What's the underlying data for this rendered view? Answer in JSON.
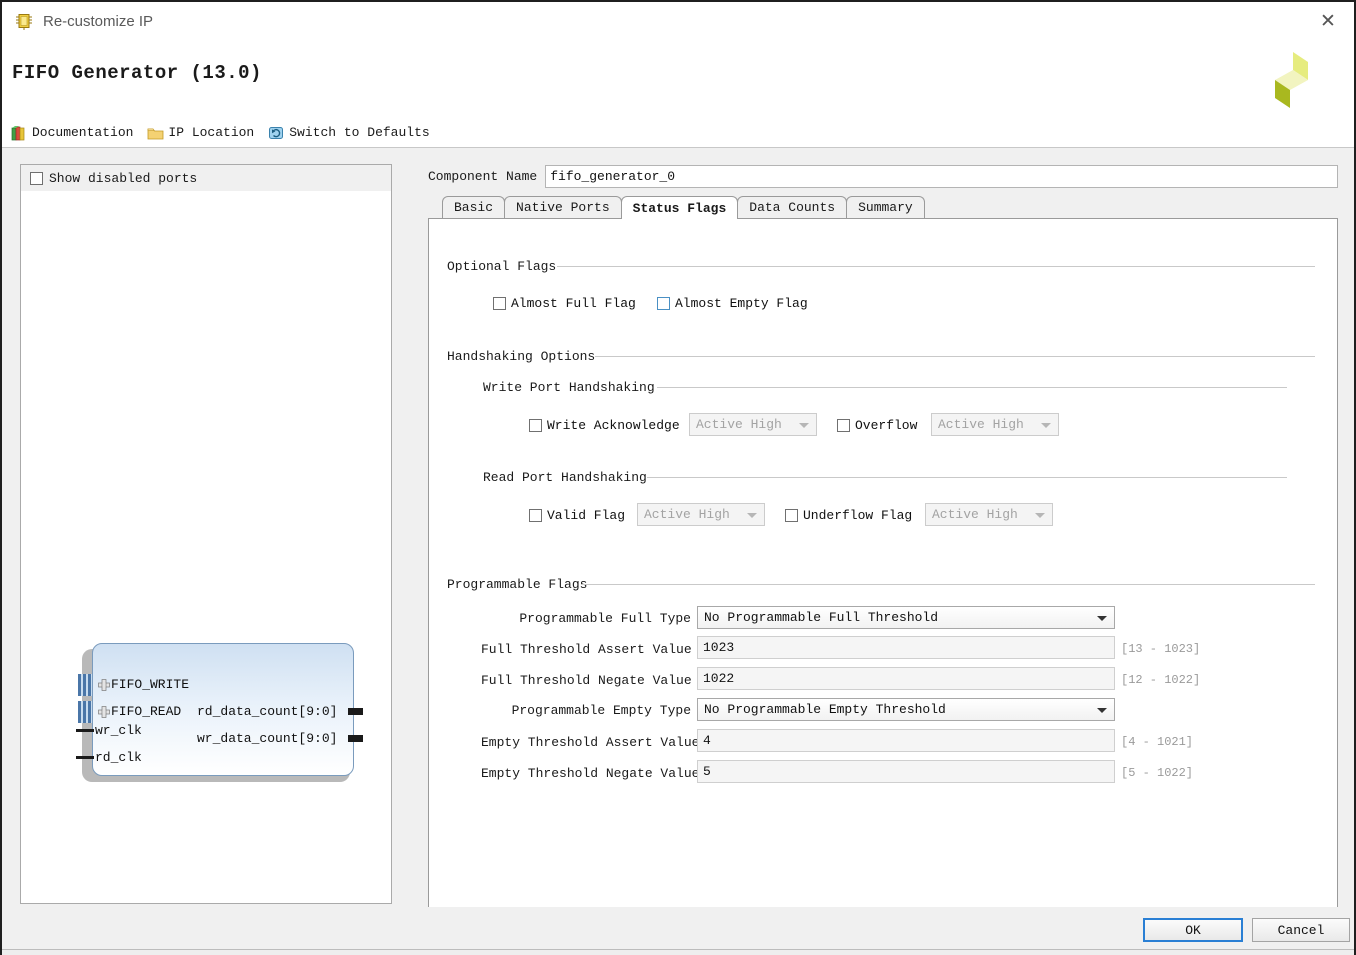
{
  "window": {
    "title": "Re-customize IP",
    "title_icon": "ip-chip-icon",
    "close_label": "✕"
  },
  "header": {
    "title": "FIFO Generator (13.0)",
    "logo": "xilinx-logo"
  },
  "toolbar": {
    "items": [
      {
        "label": "Documentation",
        "icon": "books-icon"
      },
      {
        "label": "IP Location",
        "icon": "folder-icon"
      },
      {
        "label": "Switch to Defaults",
        "icon": "refresh-icon"
      }
    ]
  },
  "left_panel": {
    "show_disabled_ports": {
      "label": "Show disabled ports",
      "checked": false
    },
    "diagram": {
      "bus_ports": [
        "FIFO_WRITE",
        "FIFO_READ"
      ],
      "clock_ports": [
        "wr_clk",
        "rd_clk"
      ],
      "output_ports": [
        "rd_data_count[9:0]",
        "wr_data_count[9:0]"
      ]
    }
  },
  "component_name": {
    "label": "Component Name",
    "value": "fifo_generator_0"
  },
  "tabs": [
    {
      "label": "Basic",
      "active": false
    },
    {
      "label": "Native Ports",
      "active": false
    },
    {
      "label": "Status Flags",
      "active": true
    },
    {
      "label": "Data Counts",
      "active": false
    },
    {
      "label": "Summary",
      "active": false
    }
  ],
  "status_flags": {
    "optional_flags": {
      "title": "Optional Flags",
      "almost_full": {
        "label": "Almost Full Flag",
        "checked": false
      },
      "almost_empty": {
        "label": "Almost Empty Flag",
        "checked": false
      }
    },
    "handshaking": {
      "title": "Handshaking Options",
      "write_port": {
        "title": "Write Port Handshaking",
        "write_acknowledge": {
          "label": "Write Acknowledge",
          "checked": false,
          "polarity": "Active High"
        },
        "overflow": {
          "label": "Overflow",
          "checked": false,
          "polarity": "Active High"
        }
      },
      "read_port": {
        "title": "Read Port Handshaking",
        "valid_flag": {
          "label": "Valid Flag",
          "checked": false,
          "polarity": "Active High"
        },
        "underflow_flag": {
          "label": "Underflow Flag",
          "checked": false,
          "polarity": "Active High"
        }
      }
    },
    "programmable_flags": {
      "title": "Programmable Flags",
      "rows": [
        {
          "label": "Programmable Full Type",
          "value": "No Programmable Full Threshold",
          "kind": "select",
          "hint": ""
        },
        {
          "label": "Full Threshold Assert Value",
          "value": "1023",
          "kind": "text",
          "hint": "[13 - 1023]"
        },
        {
          "label": "Full Threshold Negate Value",
          "value": "1022",
          "kind": "text",
          "hint": "[12 - 1022]"
        },
        {
          "label": "Programmable Empty Type",
          "value": "No Programmable Empty Threshold",
          "kind": "select",
          "hint": ""
        },
        {
          "label": "Empty Threshold Assert Value",
          "value": "4",
          "kind": "text",
          "hint": "[4 - 1021]"
        },
        {
          "label": "Empty Threshold Negate Value",
          "value": "5",
          "kind": "text",
          "hint": "[5 - 1022]"
        }
      ]
    }
  },
  "footer": {
    "ok_label": "OK",
    "cancel_label": "Cancel"
  },
  "colors": {
    "accent": "#2a7fd4",
    "logo_green": "#b5c22e",
    "logo_yellow": "#e3e86a",
    "block_fill": "#d7e6f5"
  }
}
